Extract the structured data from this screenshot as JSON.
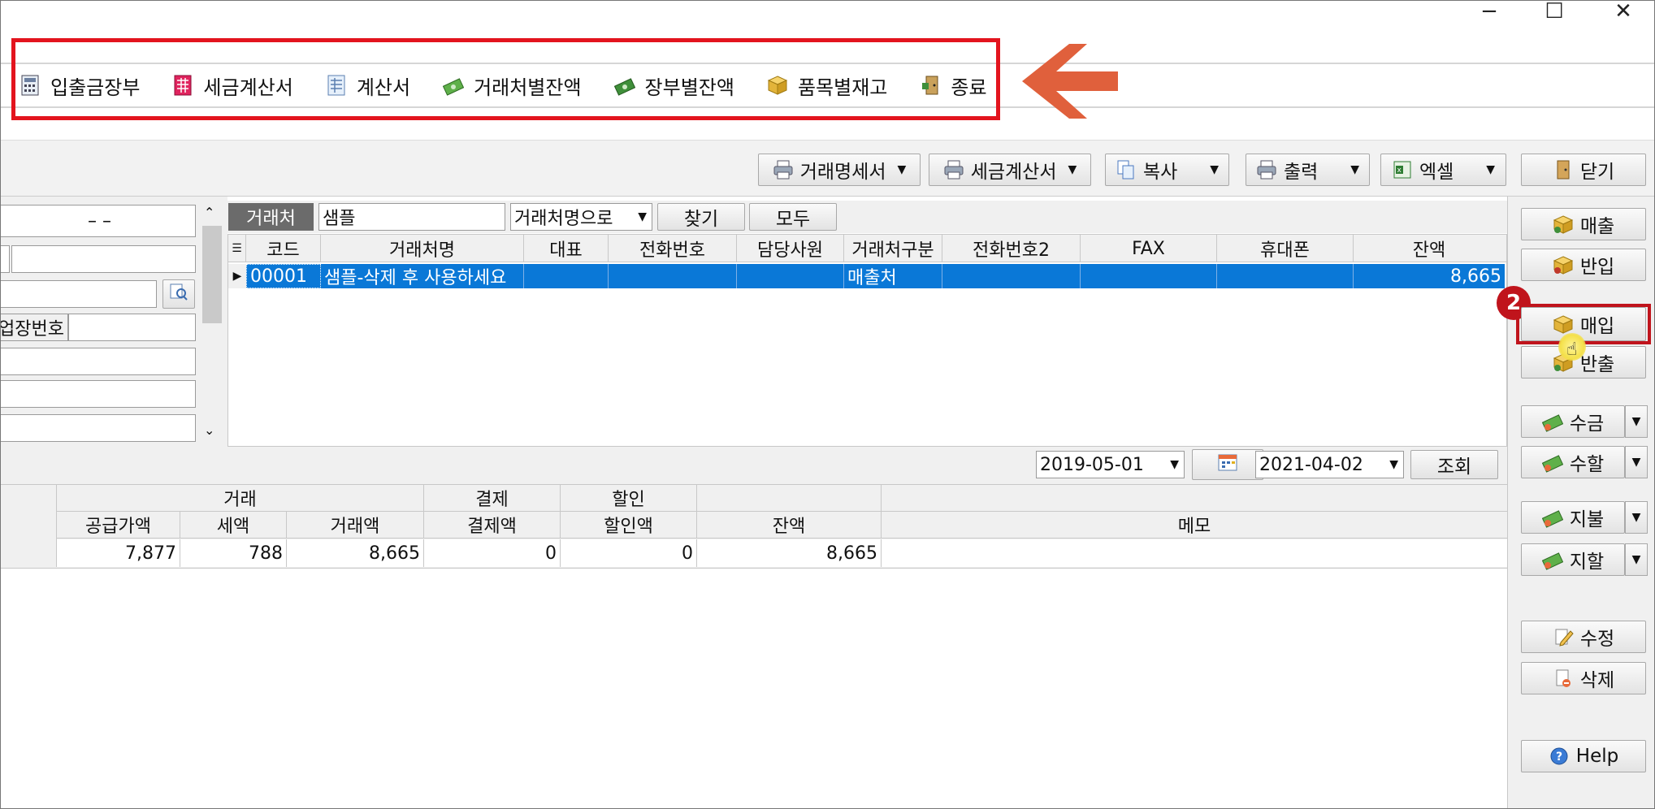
{
  "window": {
    "minimize": "−",
    "maximize": "☐",
    "close": "✕"
  },
  "toolbar": {
    "items": [
      {
        "label": "입출금장부",
        "icon": "ledger-icon"
      },
      {
        "label": "세금계산서",
        "icon": "tax-invoice-icon"
      },
      {
        "label": "계산서",
        "icon": "invoice-icon"
      },
      {
        "label": "거래처별잔액",
        "icon": "money-icon"
      },
      {
        "label": "장부별잔액",
        "icon": "money-icon"
      },
      {
        "label": "품목별재고",
        "icon": "box-icon"
      },
      {
        "label": "종료",
        "icon": "exit-door-icon"
      }
    ]
  },
  "actions": {
    "statement": "거래명세서",
    "tax_invoice": "세금계산서",
    "copy": "복사",
    "print": "출력",
    "excel": "엑셀",
    "close": "닫기"
  },
  "left_panel": {
    "phone_dash": "–   –",
    "workplace_label": "업장번호"
  },
  "search": {
    "label": "거래처",
    "value": "샘플",
    "mode": "거래처명으로",
    "find": "찾기",
    "all": "모두"
  },
  "grid": {
    "columns": [
      "코드",
      "거래처명",
      "대표",
      "전화번호",
      "담당사원",
      "거래처구분",
      "전화번호2",
      "FAX",
      "휴대폰",
      "잔액"
    ],
    "rows": [
      {
        "code": "00001",
        "name": "샘플-삭제 후 사용하세요",
        "ceo": "",
        "phone": "",
        "staff": "",
        "type": "매출처",
        "phone2": "",
        "fax": "",
        "mobile": "",
        "balance": "8,665"
      }
    ]
  },
  "dates": {
    "from": "2019-05-01",
    "to": "2021-04-02",
    "query": "조회"
  },
  "summary": {
    "group_headers": {
      "trade": "거래",
      "payment": "결제",
      "discount": "할인"
    },
    "headers": {
      "supply": "공급가액",
      "tax": "세액",
      "trade_amount": "거래액",
      "paid": "결제액",
      "discount_amount": "할인액",
      "balance": "잔액",
      "memo": "메모"
    },
    "row": {
      "supply": "7,877",
      "tax": "788",
      "trade_amount": "8,665",
      "paid": "0",
      "discount_amount": "0",
      "balance": "8,665",
      "memo": ""
    }
  },
  "side_buttons": {
    "sales": "매출",
    "return_in": "반입",
    "purchase": "매입",
    "return_out": "반출",
    "collect": "수금",
    "collect_discount": "수할",
    "pay": "지불",
    "pay_discount": "지할",
    "edit": "수정",
    "delete": "삭제",
    "help": "Help"
  },
  "step_badge": "2",
  "colors": {
    "highlight": "#e3141e",
    "arrow": "#e0603c",
    "selection": "#0a78d7",
    "badge": "#c0141c"
  }
}
